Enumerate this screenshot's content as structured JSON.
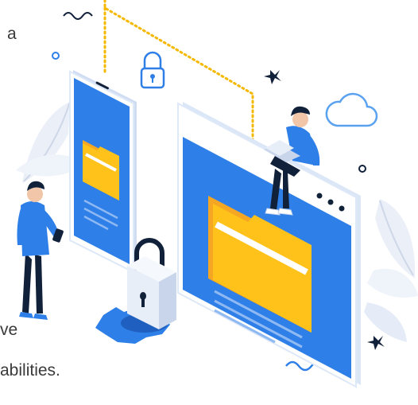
{
  "text_fragments": {
    "top": "a",
    "middle": "ve",
    "bottom": "abilities."
  },
  "illustration": {
    "theme": "secure cloud file storage",
    "icons": [
      "padlock-icon",
      "cloud-icon",
      "folder-icon",
      "gear-icon",
      "sparkle-icon"
    ]
  },
  "colors": {
    "primary_blue": "#2f7fe8",
    "light_blue": "#8fb9f2",
    "pale_blue": "#dde8f8",
    "folder_yellow": "#ffc21a",
    "folder_dark": "#f5a623",
    "dotted_orange": "#f5b800",
    "ink": "#12213a"
  }
}
